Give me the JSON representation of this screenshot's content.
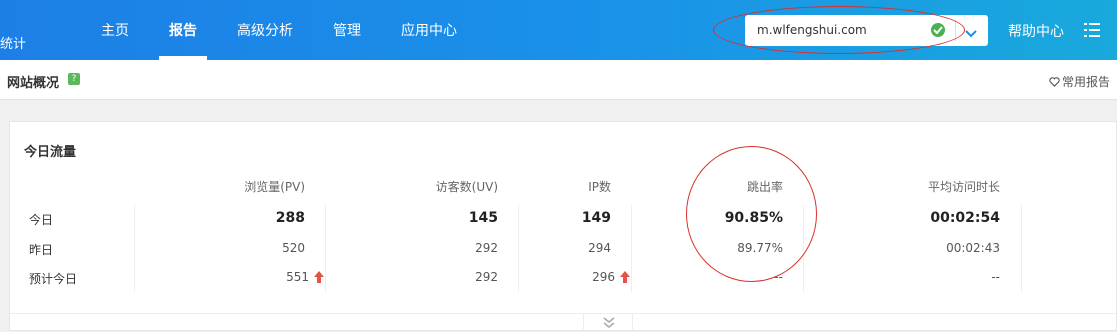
{
  "header": {
    "brand": "统计",
    "nav": [
      "主页",
      "报告",
      "高级分析",
      "管理",
      "应用中心"
    ],
    "site": "m.wlfengshui.com",
    "help": "帮助中心"
  },
  "subheader": {
    "title": "网站概况",
    "help_badge": "?",
    "favorite": "常用报告"
  },
  "card": {
    "title": "今日流量",
    "columns": [
      "浏览量(PV)",
      "访客数(UV)",
      "IP数",
      "跳出率",
      "平均访问时长"
    ],
    "rows": [
      {
        "label": "今日",
        "values": [
          "288",
          "145",
          "149",
          "90.85%",
          "00:02:54"
        ]
      },
      {
        "label": "昨日",
        "values": [
          "520",
          "292",
          "294",
          "89.77%",
          "00:02:43"
        ]
      },
      {
        "label": "预计今日",
        "values": [
          "551",
          "292",
          "296",
          "--",
          "--"
        ]
      }
    ]
  },
  "colors": {
    "header": "#1a92e8",
    "accent": "#4cb050",
    "up_arrow": "#e8504a",
    "annotation": "#d9302a"
  }
}
